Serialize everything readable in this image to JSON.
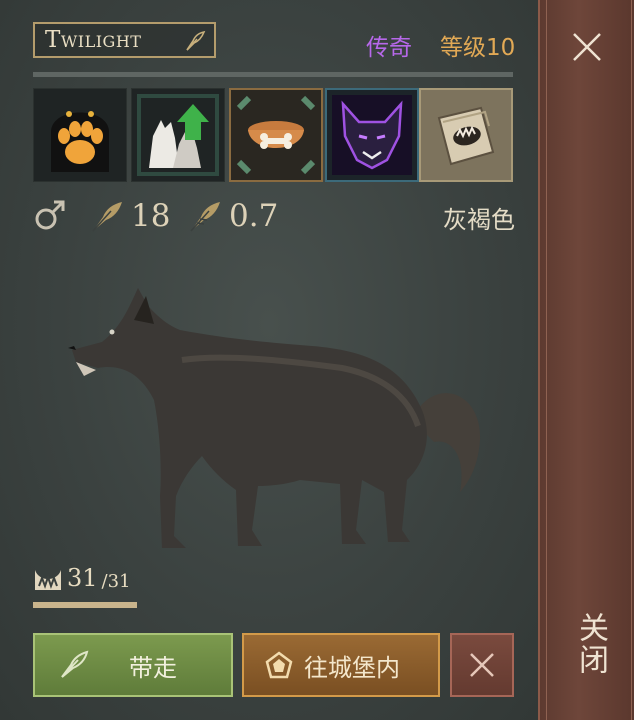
{
  "header": {
    "pet_name": "Twilight",
    "rarity": "传奇",
    "level": "等级10"
  },
  "skills": [
    {
      "icon": "paw-skill-icon"
    },
    {
      "icon": "wolf-upgrade-icon"
    },
    {
      "icon": "food-bowl-icon"
    },
    {
      "icon": "wolf-head-icon"
    },
    {
      "icon": "fang-book-icon"
    }
  ],
  "stats": {
    "gender_icon": "male-icon",
    "attack_value": "18",
    "speed_value": "0.7",
    "fur_color": "灰褐色"
  },
  "food": {
    "current": "31",
    "max": "/31",
    "fill_fraction": 1.0
  },
  "buttons": {
    "take_label": "带走",
    "castle_label": "往城堡内"
  },
  "close_panel": {
    "label": "关闭"
  },
  "colors": {
    "rarity": "#b768ea",
    "level": "#e2a955",
    "take_button": "#6e8c45",
    "castle_button": "#8a5e2c",
    "close_strip": "#6a4236"
  }
}
